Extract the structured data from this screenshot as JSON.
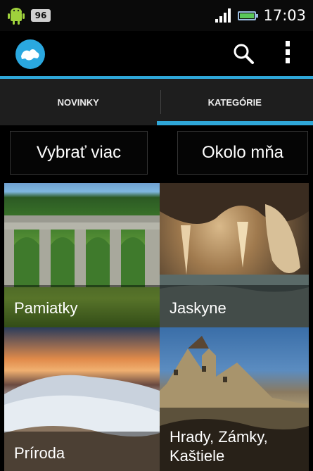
{
  "status_bar": {
    "notification_count": "96",
    "time": "17:03",
    "icons": [
      "android-icon",
      "signal-icon",
      "battery-icon"
    ]
  },
  "action_bar": {
    "icons": [
      "app-logo-icon",
      "search-icon",
      "overflow-menu-icon"
    ]
  },
  "tabs": [
    {
      "label": "NOVINKY",
      "active": false
    },
    {
      "label": "KATEGÓRIE",
      "active": true
    }
  ],
  "buttons": {
    "select_more": "Vybrať viac",
    "around_me": "Okolo mňa"
  },
  "categories": [
    {
      "label": "Pamiatky"
    },
    {
      "label": "Jaskyne"
    },
    {
      "label": "Príroda"
    },
    {
      "label": "Hrady, Zámky, Kaštiele"
    }
  ],
  "colors": {
    "accent": "#2fa7d8",
    "tab_bar_bg": "#1e1e1e",
    "background": "#000000"
  }
}
